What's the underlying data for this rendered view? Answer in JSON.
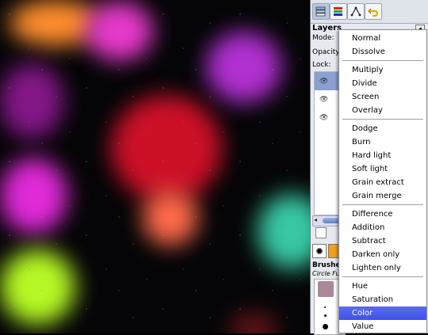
{
  "dock": {
    "layers_title": "Layers",
    "mode_label": "Mode:",
    "opacity_label": "Opacity:",
    "lock_label": "Lock:",
    "brushes_title": "Brushes",
    "brush_name": "Circle Fu"
  },
  "mode_menu": {
    "groups": [
      [
        "Normal",
        "Dissolve"
      ],
      [
        "Multiply",
        "Divide",
        "Screen",
        "Overlay"
      ],
      [
        "Dodge",
        "Burn",
        "Hard light",
        "Soft light",
        "Grain extract",
        "Grain merge"
      ],
      [
        "Difference",
        "Addition",
        "Subtract",
        "Darken only",
        "Lighten only"
      ],
      [
        "Hue",
        "Saturation",
        "Color",
        "Value"
      ]
    ],
    "highlighted": "Color",
    "highlight_color": "#3d52e6"
  },
  "canvas_colors": {
    "background": "#050507",
    "orange": "#ff8a2a",
    "magenta": "#e830c8",
    "red": "#c8102a",
    "green": "#b8ff20",
    "teal": "#30c8a0"
  }
}
